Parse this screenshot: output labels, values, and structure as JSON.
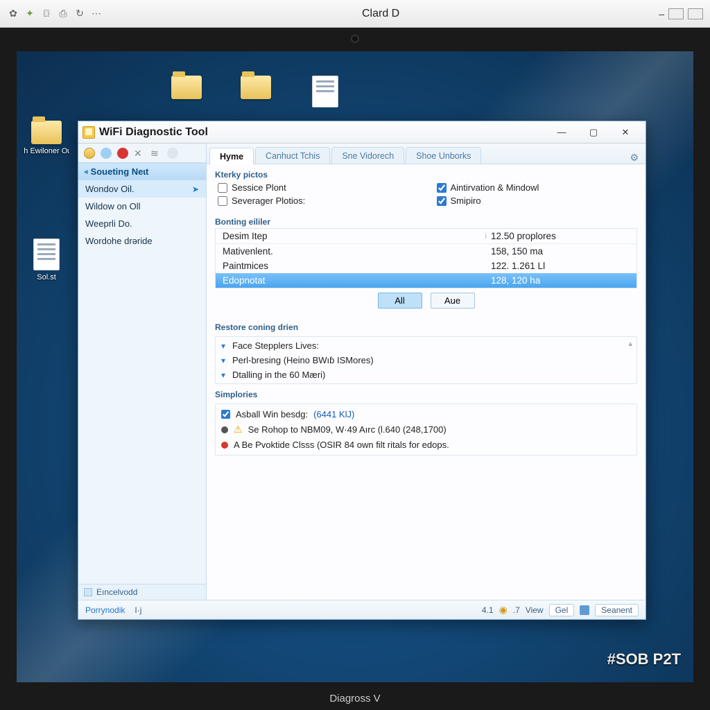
{
  "os": {
    "title": "Clard D",
    "watermark": "#SOB P2T",
    "laptop_brand": "Diagross V"
  },
  "desktop_icons": {
    "i1": "h Ewiloner Oɩ",
    "i2": "Sol.st",
    "i3": "",
    "i4": "",
    "i5": ""
  },
  "app": {
    "title": "WiFi Diagnostic Tool",
    "winbtns": {
      "min": "—",
      "max": "▢",
      "close": "✕"
    }
  },
  "sidebar": {
    "section": "Soueting Neɩt",
    "items": [
      {
        "label": "Wondov Oil.",
        "selected": true,
        "arrow": true
      },
      {
        "label": "Wildow on Oll"
      },
      {
        "label": "Weeprli Do."
      },
      {
        "label": "Wordohe drəride"
      }
    ],
    "footer": "Eıncelvodd",
    "pory": "Porrynodik",
    "pory2": "I·j"
  },
  "tabs": {
    "items": [
      {
        "label": "Hyme",
        "active": true
      },
      {
        "label": "Canhuct Tchis"
      },
      {
        "label": "Sne Vidorech"
      },
      {
        "label": "Shoe Unborks"
      }
    ]
  },
  "group1": {
    "label": "Kterky pictos",
    "checks": [
      {
        "label": "Sessice Plont",
        "checked": false
      },
      {
        "label": "Aintirvation & Mindowl",
        "checked": true
      },
      {
        "label": "Severager Plotios:",
        "checked": false
      },
      {
        "label": "Smipiro",
        "checked": true
      }
    ]
  },
  "group2": {
    "label": "Bonting eililer",
    "rows": [
      {
        "k": "Desim Itep",
        "v": "12.50 proplores"
      },
      {
        "k": "Mativenlent.",
        "v": "158, 150 ma"
      },
      {
        "k": "Paintmices",
        "v": "122. 1.261 Ll"
      },
      {
        "k": "Edopnotat",
        "v": "128, 120 ha",
        "selected": true
      }
    ],
    "col_hint": "i",
    "btn_all": "All",
    "btn_aue": "Aue"
  },
  "group3": {
    "label": "Restore coning drien",
    "rows": [
      "Face Stepplers Lives:",
      "Perl-bresing (Heino BWıɓ ISMores)",
      "Dtalling in the 60 Mæri)"
    ]
  },
  "group4": {
    "label": "Simplories",
    "items": [
      {
        "icon": "check",
        "text": "Asball Win besdg:",
        "link": "(6441 KlJ)"
      },
      {
        "icon": "warn",
        "text": "Se Rohop to NBM09, W·49 Aırc (l.640 (248,1700)"
      },
      {
        "icon": "error",
        "text": "A Be Pvoktide Clsss (OSIR 84 own filt ritals for edops."
      }
    ]
  },
  "status": {
    "left1": "4.1",
    "left2": ".7",
    "view": "View",
    "r1": "Gel",
    "r2": "Seanent"
  }
}
